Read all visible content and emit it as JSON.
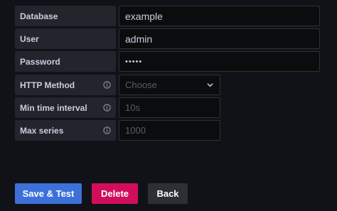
{
  "form": {
    "database": {
      "label": "Database",
      "value": "example"
    },
    "user": {
      "label": "User",
      "value": "admin"
    },
    "password": {
      "label": "Password",
      "value": "•••••"
    },
    "http_method": {
      "label": "HTTP Method",
      "placeholder": "Choose"
    },
    "min_time_interval": {
      "label": "Min time interval",
      "placeholder": "10s"
    },
    "max_series": {
      "label": "Max series",
      "placeholder": "1000"
    }
  },
  "buttons": {
    "save_test": "Save & Test",
    "delete": "Delete",
    "back": "Back"
  },
  "icons": {
    "info": "info-circle-icon",
    "select_arrow": "chevron-down-icon"
  },
  "colors": {
    "background": "#111217",
    "primary": "#3d71d9",
    "danger": "#d10e5c",
    "secondary": "#2d2f35"
  }
}
